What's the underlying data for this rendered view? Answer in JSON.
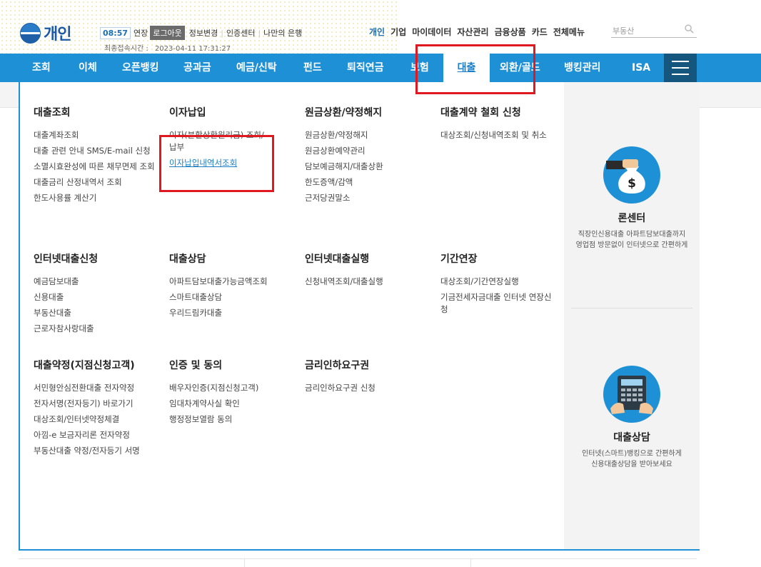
{
  "header": {
    "logo_text": "개인",
    "time": "08:57",
    "extend_label": "연장",
    "logout_label": "로그아웃",
    "util_links": [
      "정보변경",
      "인증센터",
      "나만의 은행"
    ],
    "last_login_label": "최종접속시간 :",
    "last_login_value": "2023-04-11 17:31:27",
    "top_nav": [
      "개인",
      "기업",
      "마이데이터",
      "자산관리",
      "금융상품",
      "카드",
      "전체메뉴"
    ],
    "search_placeholder": "부동산"
  },
  "gnb": {
    "items": [
      "조회",
      "이체",
      "오픈뱅킹",
      "공과금",
      "예금/신탁",
      "펀드",
      "퇴직연금",
      "보험",
      "대출",
      "외환/골드",
      "뱅킹관리",
      "ISA"
    ],
    "active": "대출"
  },
  "menu": {
    "columns": [
      {
        "title": "대출조회",
        "items": [
          "대출계좌조회",
          "대출 관련 안내 SMS/E-mail 신청",
          "소멸시효완성에 따른 채무면제 조회",
          "대출금리 산정내역서 조회",
          "한도사용률 계산기"
        ]
      },
      {
        "title": "이자납입",
        "items": [
          "이자(분할상환원리금) 조회/납부",
          "이자납입내역서조회"
        ]
      },
      {
        "title": "원금상환/약정해지",
        "items": [
          "원금상환/약정해지",
          "원금상환예약관리",
          "담보예금해지/대출상환",
          "한도증액/감액",
          "근저당권말소"
        ]
      },
      {
        "title": "대출계약 철회 신청",
        "items": [
          "대상조회/신청내역조회 및 취소"
        ]
      },
      {
        "title": "인터넷대출신청",
        "items": [
          "예금담보대출",
          "신용대출",
          "부동산대출",
          "근로자참사랑대출"
        ]
      },
      {
        "title": "대출상담",
        "items": [
          "아파트담보대출가능금액조회",
          "스마트대출상담",
          "우리드림카대출"
        ]
      },
      {
        "title": "인터넷대출실행",
        "items": [
          "신청내역조회/대출실행"
        ]
      },
      {
        "title": "기간연장",
        "items": [
          "대상조회/기간연장실행",
          "기금전세자금대출 인터넷 연장신청"
        ]
      },
      {
        "title": "대출약정(지점신청고객)",
        "items": [
          "서민형안심전환대출 전자약정",
          "전자서명(전자등기) 바로가기",
          "대상조회/인터넷약정체결",
          "아낌-e 보금자리론 전자약정",
          "부동산대출 약정/전자등기 서명"
        ]
      },
      {
        "title": "인증 및 동의",
        "items": [
          "배우자인증(지점신청고객)",
          "임대차계약사실 확인",
          "행정정보열람 동의"
        ]
      },
      {
        "title": "금리인하요구권",
        "items": [
          "금리인하요구권 신청"
        ]
      }
    ]
  },
  "promos": [
    {
      "title": "론센터",
      "desc1": "직장인신용대출 아파트담보대출까지",
      "desc2": "영업점 방문없이 인터넷으로 간편하게",
      "icon": "money-bag-icon"
    },
    {
      "title": "대출상담",
      "desc1": "인터넷(스마트)뱅킹으로 간편하게",
      "desc2": "신용대출상담을 받아보세요",
      "icon": "calculator-icon"
    }
  ],
  "colors": {
    "gnb_blue": "#1e91d6",
    "highlight_red": "#e0181f",
    "link_blue": "#1a7fc8"
  }
}
